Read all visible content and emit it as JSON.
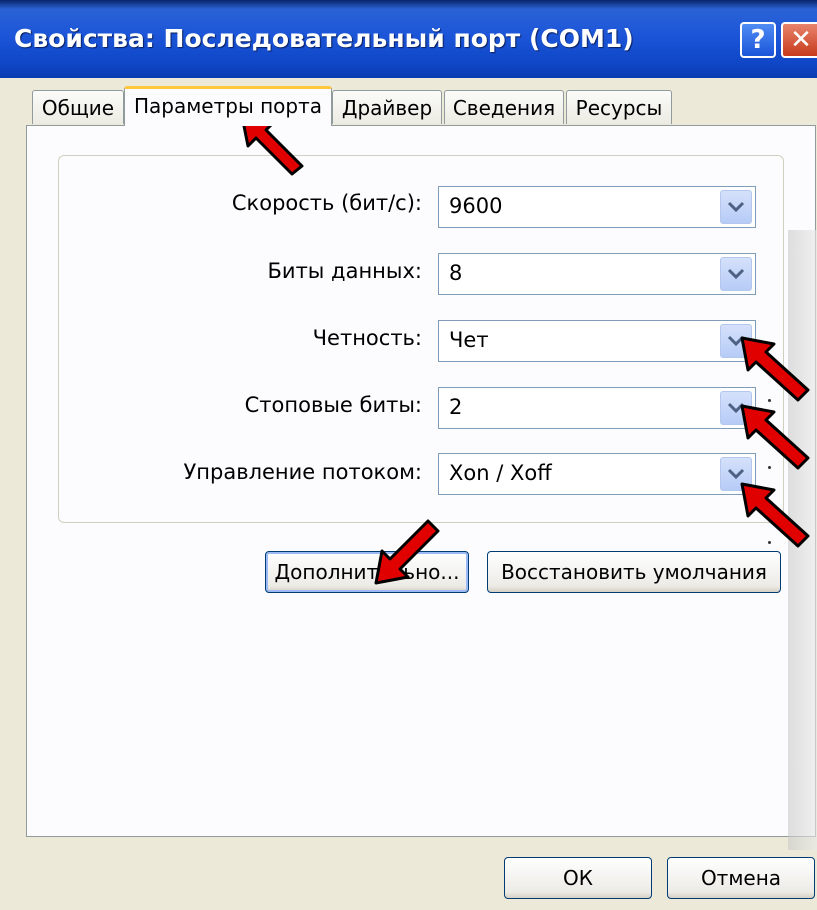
{
  "window": {
    "title": "Свойства: Последовательный порт (COM1)",
    "help_label": "?",
    "close_label": "✕"
  },
  "tabs": [
    {
      "label": "Общие",
      "active": false
    },
    {
      "label": "Параметры порта",
      "active": true
    },
    {
      "label": "Драйвер",
      "active": false
    },
    {
      "label": "Сведения",
      "active": false
    },
    {
      "label": "Ресурсы",
      "active": false
    }
  ],
  "settings": [
    {
      "label": "Скорость (бит/с):",
      "value": "9600"
    },
    {
      "label": "Биты данных:",
      "value": "8"
    },
    {
      "label": "Четность:",
      "value": "Чет"
    },
    {
      "label": "Стоповые биты:",
      "value": "2"
    },
    {
      "label": "Управление потоком:",
      "value": "Xon / Xoff"
    }
  ],
  "buttons": {
    "advanced": "Дополнительно...",
    "restore_defaults": "Восстановить умолчания",
    "ok": "ОК",
    "cancel": "Отмена"
  },
  "colors": {
    "annotation_arrow": "#e00000",
    "titlebar": "#1c55d8",
    "active_tab_accent": "#ffc83c"
  },
  "icons": {
    "dropdown": "chevron-down-icon",
    "annotation": "red-arrow-icon"
  }
}
